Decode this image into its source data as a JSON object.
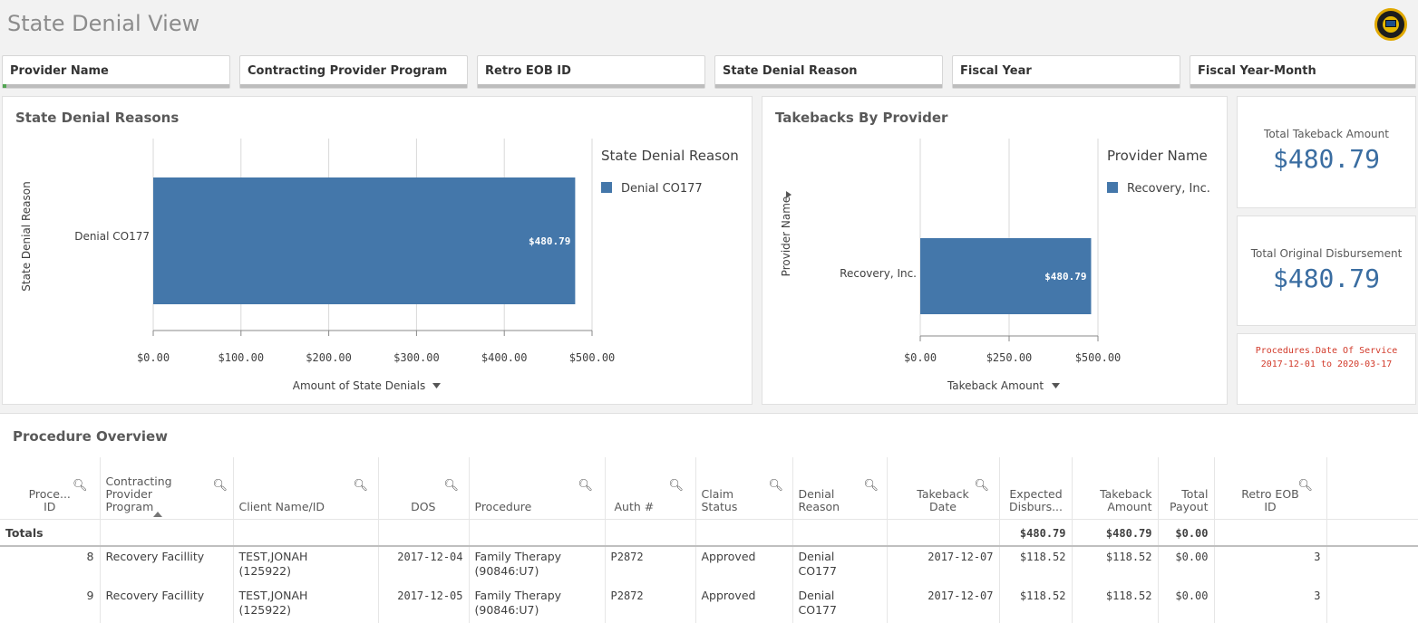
{
  "app": {
    "title": "State Denial View",
    "logo_icon": "app-logo-icon"
  },
  "filters": [
    {
      "label": "Provider Name"
    },
    {
      "label": "Contracting Provider Program"
    },
    {
      "label": "Retro EOB ID"
    },
    {
      "label": "State Denial Reason"
    },
    {
      "label": "Fiscal Year"
    },
    {
      "label": "Fiscal Year-Month"
    }
  ],
  "state_denial_panel": {
    "title": "State Denial Reasons",
    "axis_menu_icon": "dropdown-triangle-icon"
  },
  "takebacks_panel": {
    "title": "Takebacks By Provider",
    "axis_menu_icon": "dropdown-triangle-icon",
    "dimension_icon": "expand-triangle-icon"
  },
  "chart_data": [
    {
      "type": "bar",
      "orientation": "horizontal",
      "title": "State Denial Reasons",
      "categories": [
        "Denial CO177"
      ],
      "values": [
        480.79
      ],
      "data_labels": [
        "$480.79"
      ],
      "xlabel": "Amount of State Denials",
      "ylabel": "State Denial Reason",
      "xlim": [
        0,
        500
      ],
      "xticks": [
        "$0.00",
        "$100.00",
        "$200.00",
        "$300.00",
        "$400.00",
        "$500.00"
      ],
      "legend_title": "State Denial Reason",
      "legend": [
        "Denial CO177"
      ],
      "legend_position": "right",
      "grid": true,
      "color": "#4477aa"
    },
    {
      "type": "bar",
      "orientation": "horizontal",
      "title": "Takebacks By Provider",
      "categories": [
        "Recovery, Inc."
      ],
      "values": [
        480.79
      ],
      "data_labels": [
        "$480.79"
      ],
      "xlabel": "Takeback Amount",
      "ylabel": "Provider Name",
      "xlim": [
        0,
        500
      ],
      "xticks": [
        "$0.00",
        "$250.00",
        "$500.00"
      ],
      "legend_title": "Provider Name",
      "legend": [
        "Recovery, Inc."
      ],
      "legend_position": "right",
      "grid": true,
      "color": "#4477aa"
    }
  ],
  "kpis": {
    "takeback": {
      "title": "Total Takeback Amount",
      "value": "$480.79"
    },
    "disbursement": {
      "title": "Total Original Disbursement",
      "value": "$480.79"
    },
    "note": {
      "line1": "Procedures.Date Of Service",
      "line2": "2017-12-01 to 2020-03-17"
    }
  },
  "procedure_overview": {
    "title": "Procedure Overview",
    "search_icon": "search-icon",
    "columns": [
      "Proce... ID",
      "Contracting Provider Program",
      "Client Name/ID",
      "DOS",
      "Procedure",
      "Auth #",
      "Claim Status",
      "Denial Reason",
      "Takeback Date",
      "Expected Disburs...",
      "Takeback Amount",
      "Total Payout",
      "Retro EOB ID"
    ],
    "totals": {
      "label": "Totals",
      "expected": "$480.79",
      "takeback": "$480.79",
      "payout": "$0.00"
    },
    "rows": [
      {
        "id": "8",
        "program": "Recovery Facillity",
        "client1": "TEST,JONAH",
        "client2": "(125922)",
        "dos": "2017-12-04",
        "proc1": "Family Therapy",
        "proc2": "(90846:U7)",
        "auth": "P2872",
        "status": "Approved",
        "reason1": "Denial",
        "reason2": "CO177",
        "tb_date": "2017-12-07",
        "expected": "$118.52",
        "tb_amount": "$118.52",
        "payout": "$0.00",
        "eob": "3"
      },
      {
        "id": "9",
        "program": "Recovery Facillity",
        "client1": "TEST,JONAH",
        "client2": "(125922)",
        "dos": "2017-12-05",
        "proc1": "Family Therapy",
        "proc2": "(90846:U7)",
        "auth": "P2872",
        "status": "Approved",
        "reason1": "Denial",
        "reason2": "CO177",
        "tb_date": "2017-12-07",
        "expected": "$118.52",
        "tb_amount": "$118.52",
        "payout": "$0.00",
        "eob": "3"
      }
    ]
  }
}
